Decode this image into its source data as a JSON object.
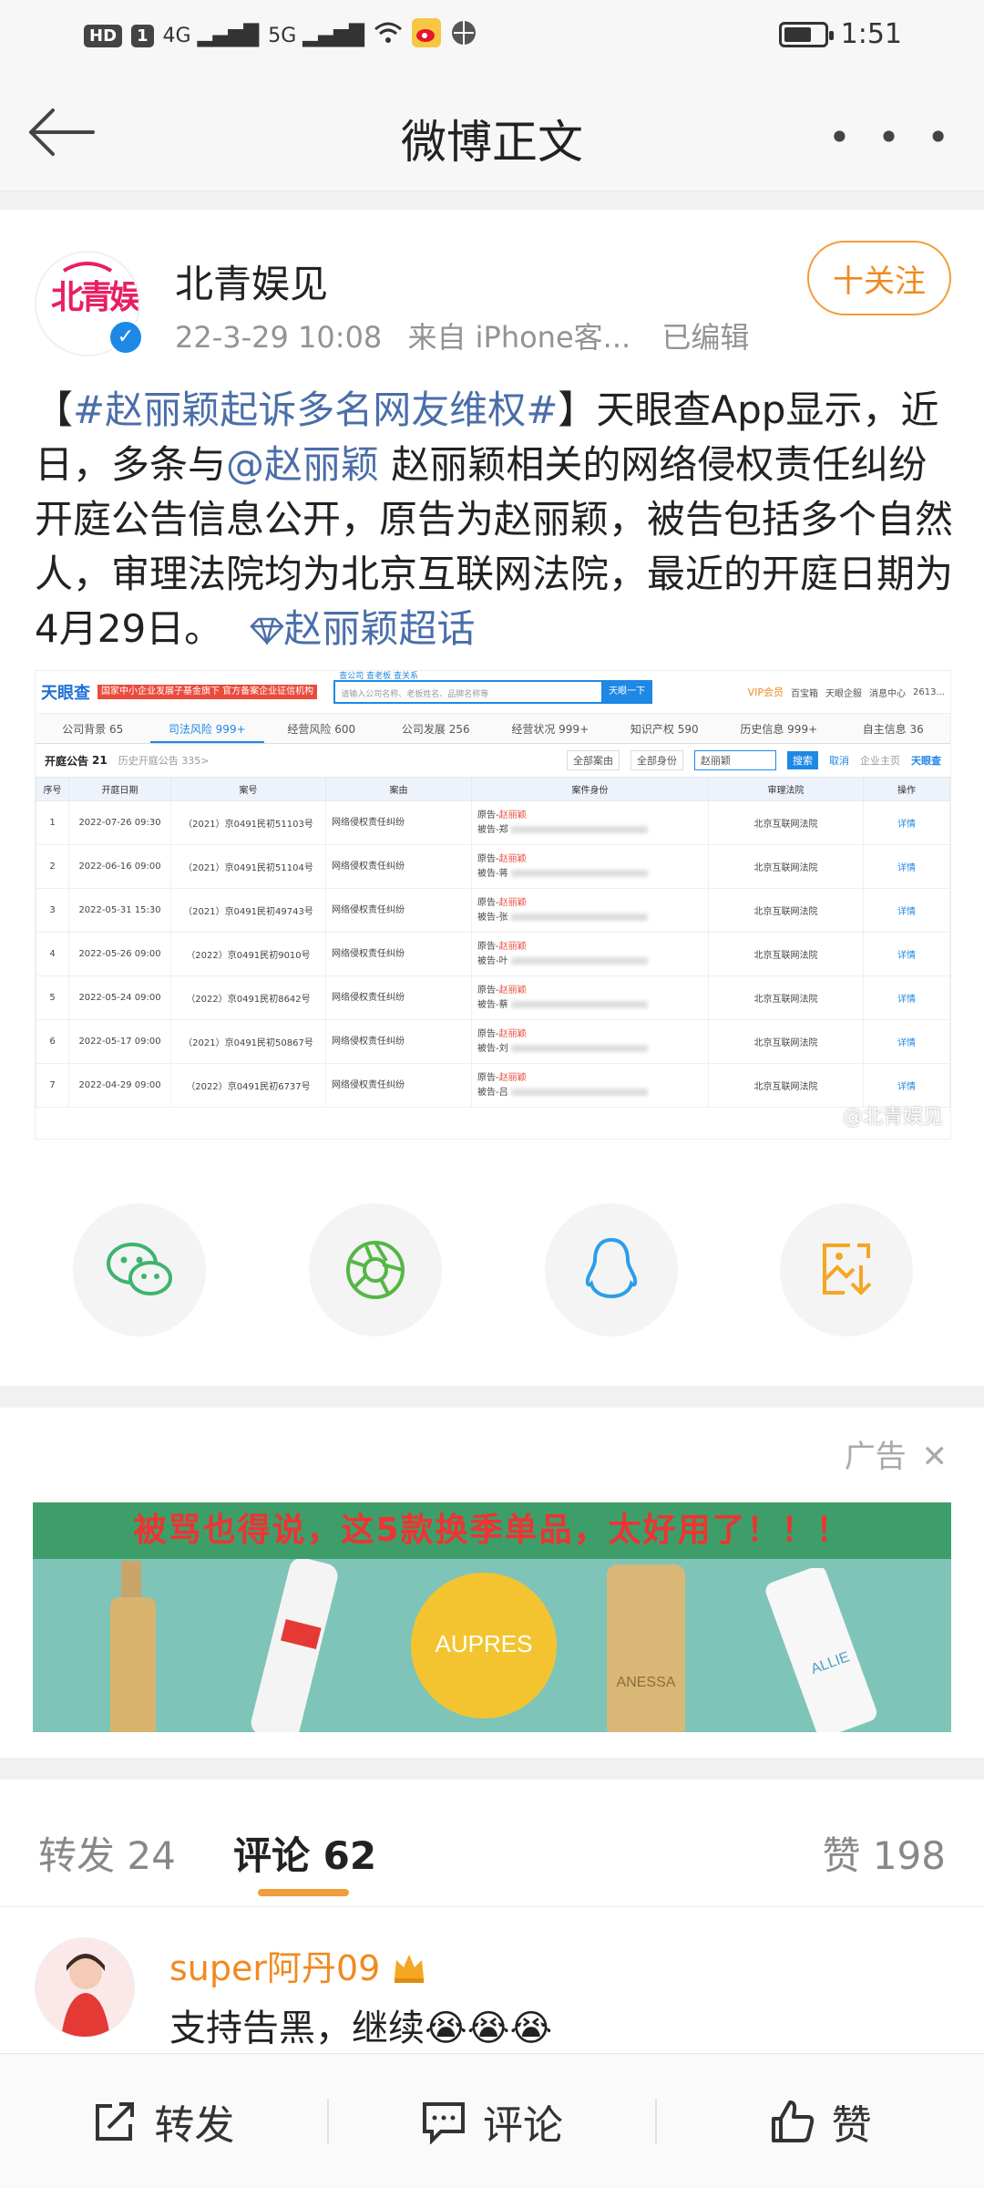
{
  "status": {
    "network": [
      "HD",
      "1",
      "4G",
      "5G"
    ],
    "time": "1:51"
  },
  "nav": {
    "title": "微博正文"
  },
  "post": {
    "author": "北青娱见",
    "avatar_text": "北青娱",
    "date": "22-3-29 10:08",
    "source": "来自 iPhone客...",
    "edited": "已编辑",
    "follow_label": "十关注",
    "content": {
      "p1": "【",
      "hashtag": "#赵丽颖起诉多名网友维权#",
      "p2": "】天眼查App显示，近日，多条与",
      "mention": "@赵丽颖",
      "p3": " 赵丽颖相关的网络侵权责任纠纷开庭公告信息公开，原告为赵丽颖，被告包括多个自然人，审理法院均为北京互联网法院，最近的开庭日期为4月29日。",
      "supertopic": "赵丽颖超话"
    }
  },
  "screenshot": {
    "brand": "天眼查",
    "brand_sub": "TianYanCha.com",
    "redtag": "国家中小企业发展子基金旗下 官方备案企业征信机构",
    "search_tabs": [
      "查公司",
      "查老板",
      "查关系"
    ],
    "search_placeholder": "请输入公司名称、老板姓名、品牌名称等",
    "search_btn": "天眼一下",
    "vip": "VIP会员",
    "header_links": [
      "百宝箱",
      "天眼企服",
      "消息中心",
      "2613..."
    ],
    "tabs": [
      "公司背景 65",
      "司法风险 999+",
      "经营风险 600",
      "公司发展 256",
      "经营状况 999+",
      "知识产权 590",
      "历史信息 999+",
      "自主信息 36"
    ],
    "sub_title": "开庭公告",
    "sub_count": "21",
    "sub_history": "历史开庭公告 335>",
    "filters": [
      "全部案由",
      "全部身份"
    ],
    "filter_search": "赵丽颖",
    "filter_btn": "搜索",
    "filter_cancel": "取消",
    "filter_brand": "企业主页",
    "columns": [
      "序号",
      "开庭日期",
      "案号",
      "案由",
      "案件身份",
      "审理法院",
      "操作"
    ],
    "rows": [
      {
        "no": "1",
        "date": "2022-07-26 09:30",
        "case": "（2021）京0491民初51103号",
        "cause": "网络侵权责任纠纷",
        "plaintiff": "原告-赵丽颖",
        "defendant": "被告-郑",
        "court": "北京互联网法院",
        "op": "详情"
      },
      {
        "no": "2",
        "date": "2022-06-16 09:00",
        "case": "（2021）京0491民初51104号",
        "cause": "网络侵权责任纠纷",
        "plaintiff": "原告-赵丽颖",
        "defendant": "被告-蒋",
        "court": "北京互联网法院",
        "op": "详情"
      },
      {
        "no": "3",
        "date": "2022-05-31 15:30",
        "case": "（2021）京0491民初49743号",
        "cause": "网络侵权责任纠纷",
        "plaintiff": "原告-赵丽颖",
        "defendant": "被告-张",
        "court": "北京互联网法院",
        "op": "详情"
      },
      {
        "no": "4",
        "date": "2022-05-26 09:00",
        "case": "（2022）京0491民初9010号",
        "cause": "网络侵权责任纠纷",
        "plaintiff": "原告-赵丽颖",
        "defendant": "被告-叶",
        "court": "北京互联网法院",
        "op": "详情"
      },
      {
        "no": "5",
        "date": "2022-05-24 09:00",
        "case": "（2022）京0491民初8642号",
        "cause": "网络侵权责任纠纷",
        "plaintiff": "原告-赵丽颖",
        "defendant": "被告-蔡",
        "court": "北京互联网法院",
        "op": "详情"
      },
      {
        "no": "6",
        "date": "2022-05-17 09:00",
        "case": "（2021）京0491民初50867号",
        "cause": "网络侵权责任纠纷",
        "plaintiff": "原告-赵丽颖",
        "defendant": "被告-刘",
        "court": "北京互联网法院",
        "op": "详情"
      },
      {
        "no": "7",
        "date": "2022-04-29 09:00",
        "case": "（2022）京0491民初6737号",
        "cause": "网络侵权责任纠纷",
        "plaintiff": "原告-赵丽颖",
        "defendant": "被告-吕",
        "court": "北京互联网法院",
        "op": "详情"
      }
    ],
    "watermark": "@北青娱见"
  },
  "ad": {
    "label": "广告",
    "banner_text": "被骂也得说，这5款换季单品，太好用了！！！",
    "products": [
      "AUPRES",
      "ANESSA",
      "ALLIE"
    ]
  },
  "tabs": {
    "repost": "转发 24",
    "comment": "评论 62",
    "like": "赞 198"
  },
  "comment": {
    "user": "super阿丹09",
    "text": "支持告黑，继续😭😭😭"
  },
  "bottombar": {
    "repost": "转发",
    "comment": "评论",
    "like": "赞"
  },
  "colors": {
    "accent": "#f39c3c",
    "link": "#4a6ea9",
    "brand_blue": "#1e88e5"
  }
}
